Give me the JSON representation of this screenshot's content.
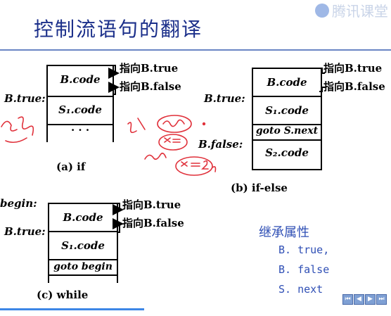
{
  "header": {
    "title": "控制流语句的翻译",
    "watermark": "腾讯课堂"
  },
  "diagram_if": {
    "code": "B.code",
    "s1": "S₁.code",
    "dots": "· · ·",
    "label_btrue": "B.true:",
    "arrow_true": "指向B.true",
    "arrow_false": "指向B.false",
    "caption": "(a) if"
  },
  "diagram_ifelse": {
    "code": "B.code",
    "s1": "S₁.code",
    "goto": "goto S.next",
    "s2": "S₂.code",
    "label_btrue": "B.true:",
    "label_bfalse": "B.false:",
    "arrow_true": "指向B.true",
    "arrow_false": "指向B.false",
    "caption": "(b) if-else"
  },
  "diagram_while": {
    "label_begin": "begin:",
    "label_btrue": "B.true:",
    "code": "B.code",
    "s1": "S₁.code",
    "goto": "goto begin",
    "arrow_true": "指向B.true",
    "arrow_false": "指向B.false",
    "caption": "(c) while"
  },
  "notes": {
    "heading": "继承属性",
    "items": [
      "B. true,",
      "B. false",
      "S. next"
    ]
  },
  "nav": [
    "⏮",
    "◀",
    "▶",
    "⏭"
  ],
  "colors": {
    "title": "#1b2f8a",
    "note": "#2f4fb5",
    "annotation": "#e0303a"
  }
}
